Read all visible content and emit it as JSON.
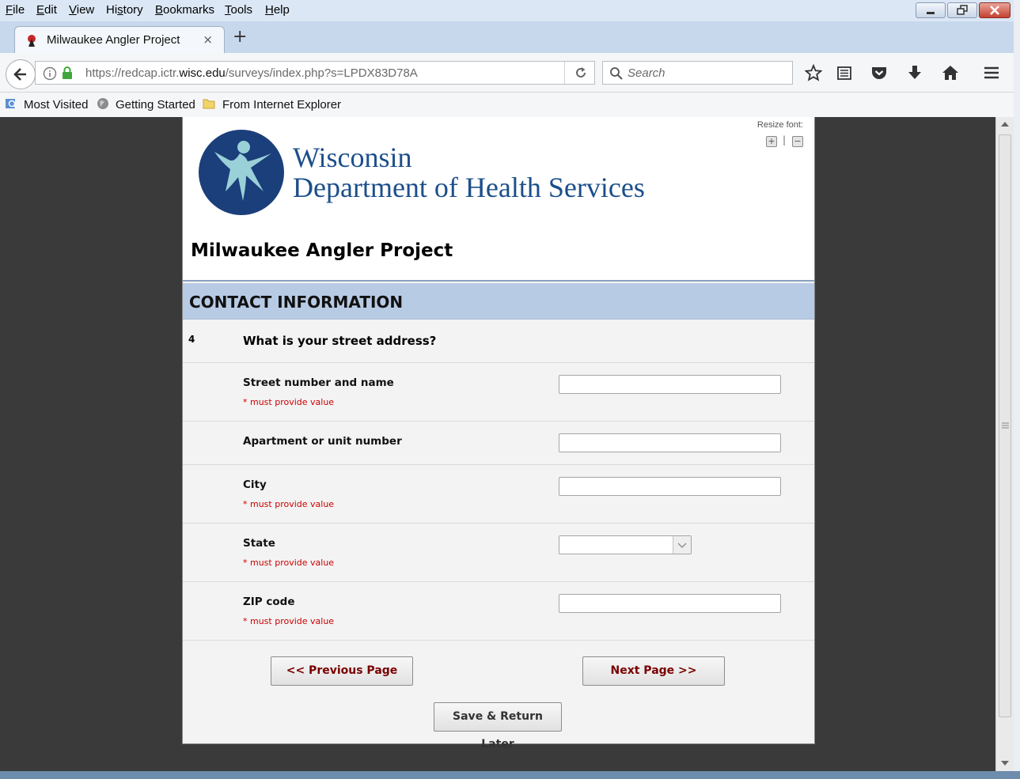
{
  "menu": {
    "items": [
      {
        "u": "F",
        "rest": "ile"
      },
      {
        "u": "E",
        "rest": "dit"
      },
      {
        "u": "V",
        "rest": "iew"
      },
      {
        "u": "",
        "pre": "Hi",
        "us": "s",
        "post": "tory"
      },
      {
        "u": "B",
        "rest": "ookmarks"
      },
      {
        "u": "T",
        "rest": "ools"
      },
      {
        "u": "H",
        "rest": "elp"
      }
    ]
  },
  "tab": {
    "title": "Milwaukee Angler Project",
    "close": "×",
    "new_tab": "+"
  },
  "nav": {
    "url_prefix": "https://redcap.ictr.",
    "url_domain": "wisc.edu",
    "url_suffix": "/surveys/index.php?s=LPDX83D78A",
    "search_placeholder": "Search"
  },
  "bookmarks": {
    "items": [
      "Most Visited",
      "Getting Started",
      "From Internet Explorer"
    ]
  },
  "header": {
    "resize_label": "Resize font:",
    "resize_sep": "|",
    "org_line1": "Wisconsin",
    "org_line2": "Department of Health Services",
    "survey_title": "Milwaukee Angler Project"
  },
  "section": {
    "title": "CONTACT INFORMATION"
  },
  "question": {
    "number": "4",
    "text": "What is your street address?"
  },
  "fields": [
    {
      "label": "Street number and name",
      "required": "* must provide value"
    },
    {
      "label": "Apartment or unit number",
      "required": ""
    },
    {
      "label": "City",
      "required": "* must provide value"
    },
    {
      "label": "State",
      "required": "* must provide value"
    },
    {
      "label": "ZIP code",
      "required": "* must provide value"
    }
  ],
  "buttons": {
    "previous": "<< Previous Page",
    "next": "Next Page >>",
    "save": "Save & Return Later"
  },
  "colors": {
    "section_bg": "#b8cbe5",
    "org_blue": "#1c4f8a",
    "required_red": "#cc0000",
    "nav_button_text": "#7a0000"
  },
  "icons": [
    "back-arrow-icon",
    "info-icon",
    "lock-icon",
    "reload-icon",
    "search-icon",
    "star-icon",
    "reading-list-icon",
    "pocket-icon",
    "download-icon",
    "home-icon",
    "hamburger-menu-icon"
  ]
}
